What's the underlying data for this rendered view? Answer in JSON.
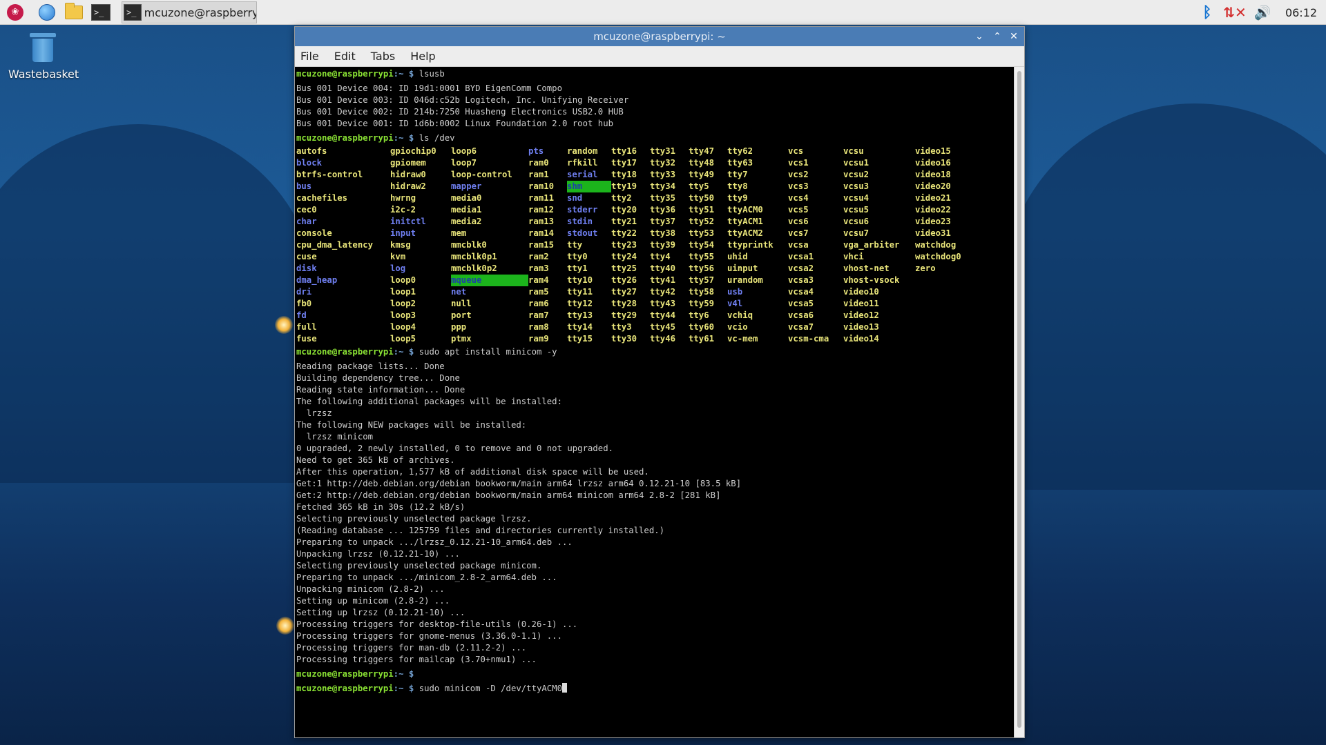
{
  "taskbar": {
    "task_label": "mcuzone@raspberry...",
    "clock": "06:12",
    "tray_icons": [
      "bluetooth-icon",
      "network-disconnected-icon",
      "volume-icon"
    ]
  },
  "desktop": {
    "wastebasket_label": "Wastebasket"
  },
  "window": {
    "title": "mcuzone@raspberrypi: ~",
    "menu": [
      "File",
      "Edit",
      "Tabs",
      "Help"
    ]
  },
  "terminal": {
    "prompt_user": "mcuzone@raspberrypi",
    "prompt_path": ":~ $",
    "cmd1": " lsusb",
    "lsusb_output": "Bus 001 Device 004: ID 19d1:0001 BYD EigenComm Compo\nBus 001 Device 003: ID 046d:c52b Logitech, Inc. Unifying Receiver\nBus 001 Device 002: ID 214b:7250 Huasheng Electronics USB2.0 HUB\nBus 001 Device 001: ID 1d6b:0002 Linux Foundation 2.0 root hub",
    "cmd2": " ls /dev",
    "ls_dev": [
      [
        "autofs",
        "y"
      ],
      [
        "gpiochip0",
        "y"
      ],
      [
        "loop6",
        "y"
      ],
      [
        "pts",
        "b"
      ],
      [
        "random",
        "y"
      ],
      [
        "tty16",
        "y"
      ],
      [
        "tty31",
        "y"
      ],
      [
        "tty47",
        "y"
      ],
      [
        "tty62",
        "y"
      ],
      [
        "vcs",
        "y"
      ],
      [
        "vcsu",
        "y"
      ],
      [
        "video15",
        "y"
      ],
      [
        "block",
        "b"
      ],
      [
        "gpiomem",
        "y"
      ],
      [
        "loop7",
        "y"
      ],
      [
        "ram0",
        "y"
      ],
      [
        "rfkill",
        "y"
      ],
      [
        "tty17",
        "y"
      ],
      [
        "tty32",
        "y"
      ],
      [
        "tty48",
        "y"
      ],
      [
        "tty63",
        "y"
      ],
      [
        "vcs1",
        "y"
      ],
      [
        "vcsu1",
        "y"
      ],
      [
        "video16",
        "y"
      ],
      [
        "btrfs-control",
        "y"
      ],
      [
        "hidraw0",
        "y"
      ],
      [
        "loop-control",
        "y"
      ],
      [
        "ram1",
        "y"
      ],
      [
        "serial",
        "b"
      ],
      [
        "tty18",
        "y"
      ],
      [
        "tty33",
        "y"
      ],
      [
        "tty49",
        "y"
      ],
      [
        "tty7",
        "y"
      ],
      [
        "vcs2",
        "y"
      ],
      [
        "vcsu2",
        "y"
      ],
      [
        "video18",
        "y"
      ],
      [
        "bus",
        "b"
      ],
      [
        "hidraw2",
        "y"
      ],
      [
        "mapper",
        "b"
      ],
      [
        "ram10",
        "y"
      ],
      [
        "shm",
        "g"
      ],
      [
        "tty19",
        "y"
      ],
      [
        "tty34",
        "y"
      ],
      [
        "tty5",
        "y"
      ],
      [
        "tty8",
        "y"
      ],
      [
        "vcs3",
        "y"
      ],
      [
        "vcsu3",
        "y"
      ],
      [
        "video20",
        "y"
      ],
      [
        "cachefiles",
        "y"
      ],
      [
        "hwrng",
        "y"
      ],
      [
        "media0",
        "y"
      ],
      [
        "ram11",
        "y"
      ],
      [
        "snd",
        "b"
      ],
      [
        "tty2",
        "y"
      ],
      [
        "tty35",
        "y"
      ],
      [
        "tty50",
        "y"
      ],
      [
        "tty9",
        "y"
      ],
      [
        "vcs4",
        "y"
      ],
      [
        "vcsu4",
        "y"
      ],
      [
        "video21",
        "y"
      ],
      [
        "cec0",
        "y"
      ],
      [
        "i2c-2",
        "y"
      ],
      [
        "media1",
        "y"
      ],
      [
        "ram12",
        "y"
      ],
      [
        "stderr",
        "b"
      ],
      [
        "tty20",
        "y"
      ],
      [
        "tty36",
        "y"
      ],
      [
        "tty51",
        "y"
      ],
      [
        "ttyACM0",
        "y"
      ],
      [
        "vcs5",
        "y"
      ],
      [
        "vcsu5",
        "y"
      ],
      [
        "video22",
        "y"
      ],
      [
        "char",
        "b"
      ],
      [
        "initctl",
        "b"
      ],
      [
        "media2",
        "y"
      ],
      [
        "ram13",
        "y"
      ],
      [
        "stdin",
        "b"
      ],
      [
        "tty21",
        "y"
      ],
      [
        "tty37",
        "y"
      ],
      [
        "tty52",
        "y"
      ],
      [
        "ttyACM1",
        "y"
      ],
      [
        "vcs6",
        "y"
      ],
      [
        "vcsu6",
        "y"
      ],
      [
        "video23",
        "y"
      ],
      [
        "console",
        "y"
      ],
      [
        "input",
        "b"
      ],
      [
        "mem",
        "y"
      ],
      [
        "ram14",
        "y"
      ],
      [
        "stdout",
        "b"
      ],
      [
        "tty22",
        "y"
      ],
      [
        "tty38",
        "y"
      ],
      [
        "tty53",
        "y"
      ],
      [
        "ttyACM2",
        "y"
      ],
      [
        "vcs7",
        "y"
      ],
      [
        "vcsu7",
        "y"
      ],
      [
        "video31",
        "y"
      ],
      [
        "cpu_dma_latency",
        "y"
      ],
      [
        "kmsg",
        "y"
      ],
      [
        "mmcblk0",
        "y"
      ],
      [
        "ram15",
        "y"
      ],
      [
        "tty",
        "y"
      ],
      [
        "tty23",
        "y"
      ],
      [
        "tty39",
        "y"
      ],
      [
        "tty54",
        "y"
      ],
      [
        "ttyprintk",
        "y"
      ],
      [
        "vcsa",
        "y"
      ],
      [
        "vga_arbiter",
        "y"
      ],
      [
        "watchdog",
        "y"
      ],
      [
        "cuse",
        "y"
      ],
      [
        "kvm",
        "y"
      ],
      [
        "mmcblk0p1",
        "y"
      ],
      [
        "ram2",
        "y"
      ],
      [
        "tty0",
        "y"
      ],
      [
        "tty24",
        "y"
      ],
      [
        "tty4",
        "y"
      ],
      [
        "tty55",
        "y"
      ],
      [
        "uhid",
        "y"
      ],
      [
        "vcsa1",
        "y"
      ],
      [
        "vhci",
        "y"
      ],
      [
        "watchdog0",
        "y"
      ],
      [
        "disk",
        "b"
      ],
      [
        "log",
        "b"
      ],
      [
        "mmcblk0p2",
        "y"
      ],
      [
        "ram3",
        "y"
      ],
      [
        "tty1",
        "y"
      ],
      [
        "tty25",
        "y"
      ],
      [
        "tty40",
        "y"
      ],
      [
        "tty56",
        "y"
      ],
      [
        "uinput",
        "y"
      ],
      [
        "vcsa2",
        "y"
      ],
      [
        "vhost-net",
        "y"
      ],
      [
        "zero",
        "y"
      ],
      [
        "dma_heap",
        "b"
      ],
      [
        "loop0",
        "y"
      ],
      [
        "mqueue",
        "g"
      ],
      [
        "ram4",
        "y"
      ],
      [
        "tty10",
        "y"
      ],
      [
        "tty26",
        "y"
      ],
      [
        "tty41",
        "y"
      ],
      [
        "tty57",
        "y"
      ],
      [
        "urandom",
        "y"
      ],
      [
        "vcsa3",
        "y"
      ],
      [
        "vhost-vsock",
        "y"
      ],
      [
        "",
        ""
      ],
      [
        "dri",
        "b"
      ],
      [
        "loop1",
        "y"
      ],
      [
        "net",
        "b"
      ],
      [
        "ram5",
        "y"
      ],
      [
        "tty11",
        "y"
      ],
      [
        "tty27",
        "y"
      ],
      [
        "tty42",
        "y"
      ],
      [
        "tty58",
        "y"
      ],
      [
        "usb",
        "b"
      ],
      [
        "vcsa4",
        "y"
      ],
      [
        "video10",
        "y"
      ],
      [
        "",
        ""
      ],
      [
        "fb0",
        "y"
      ],
      [
        "loop2",
        "y"
      ],
      [
        "null",
        "y"
      ],
      [
        "ram6",
        "y"
      ],
      [
        "tty12",
        "y"
      ],
      [
        "tty28",
        "y"
      ],
      [
        "tty43",
        "y"
      ],
      [
        "tty59",
        "y"
      ],
      [
        "v4l",
        "b"
      ],
      [
        "vcsa5",
        "y"
      ],
      [
        "video11",
        "y"
      ],
      [
        "",
        ""
      ],
      [
        "fd",
        "b"
      ],
      [
        "loop3",
        "y"
      ],
      [
        "port",
        "y"
      ],
      [
        "ram7",
        "y"
      ],
      [
        "tty13",
        "y"
      ],
      [
        "tty29",
        "y"
      ],
      [
        "tty44",
        "y"
      ],
      [
        "tty6",
        "y"
      ],
      [
        "vchiq",
        "y"
      ],
      [
        "vcsa6",
        "y"
      ],
      [
        "video12",
        "y"
      ],
      [
        "",
        ""
      ],
      [
        "full",
        "y"
      ],
      [
        "loop4",
        "y"
      ],
      [
        "ppp",
        "y"
      ],
      [
        "ram8",
        "y"
      ],
      [
        "tty14",
        "y"
      ],
      [
        "tty3",
        "y"
      ],
      [
        "tty45",
        "y"
      ],
      [
        "tty60",
        "y"
      ],
      [
        "vcio",
        "y"
      ],
      [
        "vcsa7",
        "y"
      ],
      [
        "video13",
        "y"
      ],
      [
        "",
        ""
      ],
      [
        "fuse",
        "y"
      ],
      [
        "loop5",
        "y"
      ],
      [
        "ptmx",
        "y"
      ],
      [
        "ram9",
        "y"
      ],
      [
        "tty15",
        "y"
      ],
      [
        "tty30",
        "y"
      ],
      [
        "tty46",
        "y"
      ],
      [
        "tty61",
        "y"
      ],
      [
        "vc-mem",
        "y"
      ],
      [
        "vcsm-cma",
        "y"
      ],
      [
        "video14",
        "y"
      ],
      [
        "",
        ""
      ]
    ],
    "cmd3": " sudo apt install minicom -y",
    "apt_output": "Reading package lists... Done\nBuilding dependency tree... Done\nReading state information... Done\nThe following additional packages will be installed:\n  lrzsz\nThe following NEW packages will be installed:\n  lrzsz minicom\n0 upgraded, 2 newly installed, 0 to remove and 0 not upgraded.\nNeed to get 365 kB of archives.\nAfter this operation, 1,577 kB of additional disk space will be used.\nGet:1 http://deb.debian.org/debian bookworm/main arm64 lrzsz arm64 0.12.21-10 [83.5 kB]\nGet:2 http://deb.debian.org/debian bookworm/main arm64 minicom arm64 2.8-2 [281 kB]\nFetched 365 kB in 30s (12.2 kB/s)\nSelecting previously unselected package lrzsz.\n(Reading database ... 125759 files and directories currently installed.)\nPreparing to unpack .../lrzsz_0.12.21-10_arm64.deb ...\nUnpacking lrzsz (0.12.21-10) ...\nSelecting previously unselected package minicom.\nPreparing to unpack .../minicom_2.8-2_arm64.deb ...\nUnpacking minicom (2.8-2) ...\nSetting up minicom (2.8-2) ...\nSetting up lrzsz (0.12.21-10) ...\nProcessing triggers for desktop-file-utils (0.26-1) ...\nProcessing triggers for gnome-menus (3.36.0-1.1) ...\nProcessing triggers for man-db (2.11.2-2) ...\nProcessing triggers for mailcap (3.70+nmu1) ...",
    "cmd4": "",
    "cmd5": " sudo minicom -D /dev/ttyACM0"
  }
}
